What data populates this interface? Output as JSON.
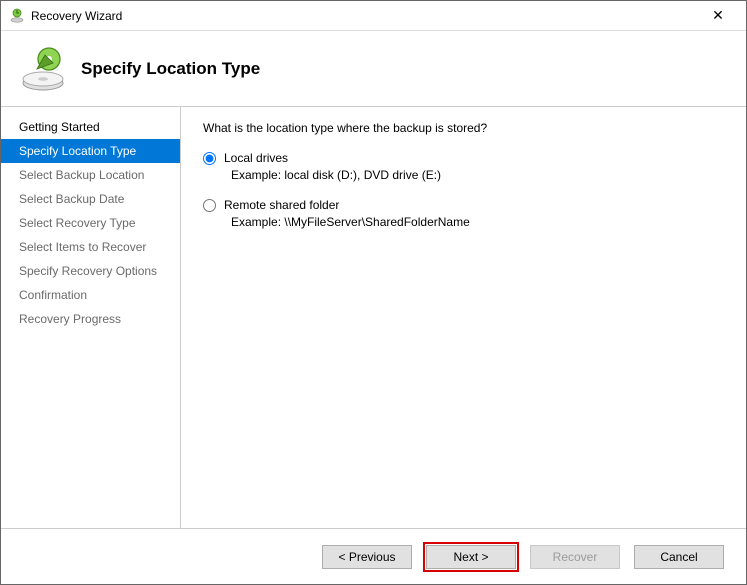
{
  "window": {
    "title": "Recovery Wizard",
    "close_glyph": "✕"
  },
  "header": {
    "title": "Specify Location Type"
  },
  "sidebar": {
    "items": [
      {
        "label": "Getting Started",
        "state": "done"
      },
      {
        "label": "Specify Location Type",
        "state": "active"
      },
      {
        "label": "Select Backup Location",
        "state": "future"
      },
      {
        "label": "Select Backup Date",
        "state": "future"
      },
      {
        "label": "Select Recovery Type",
        "state": "future"
      },
      {
        "label": "Select Items to Recover",
        "state": "future"
      },
      {
        "label": "Specify Recovery Options",
        "state": "future"
      },
      {
        "label": "Confirmation",
        "state": "future"
      },
      {
        "label": "Recovery Progress",
        "state": "future"
      }
    ]
  },
  "content": {
    "question": "What is the location type where the backup is stored?",
    "options": [
      {
        "label": "Local drives",
        "example": "Example: local disk (D:), DVD drive (E:)",
        "selected": true
      },
      {
        "label": "Remote shared folder",
        "example": "Example: \\\\MyFileServer\\SharedFolderName",
        "selected": false
      }
    ]
  },
  "footer": {
    "previous": "< Previous",
    "next": "Next >",
    "recover": "Recover",
    "cancel": "Cancel",
    "recover_disabled": true,
    "next_highlight": true
  }
}
